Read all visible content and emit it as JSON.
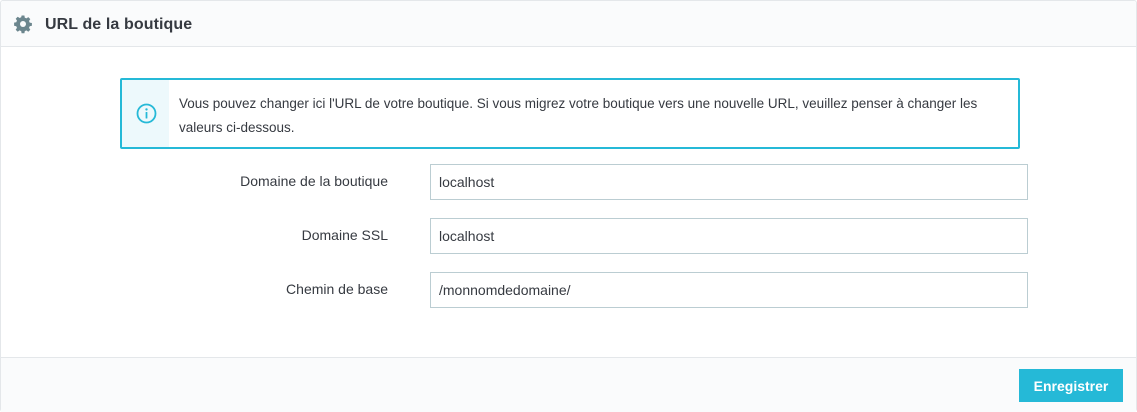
{
  "panel": {
    "title": "URL de la boutique",
    "icon": "gear-icon"
  },
  "alert": {
    "icon": "info-icon",
    "text": "Vous pouvez changer ici l'URL de votre boutique. Si vous migrez votre boutique vers une nouvelle URL, veuillez penser à changer les valeurs ci-dessous."
  },
  "form": {
    "fields": [
      {
        "label": "Domaine de la boutique",
        "value": "localhost"
      },
      {
        "label": "Domaine SSL",
        "value": "localhost"
      },
      {
        "label": "Chemin de base",
        "value": "/monnomdedomaine/"
      }
    ]
  },
  "footer": {
    "save_label": "Enregistrer"
  },
  "colors": {
    "accent": "#25b9d7",
    "text": "#363a41",
    "border": "#bbcdd2",
    "header_bg": "#fafbfc"
  }
}
